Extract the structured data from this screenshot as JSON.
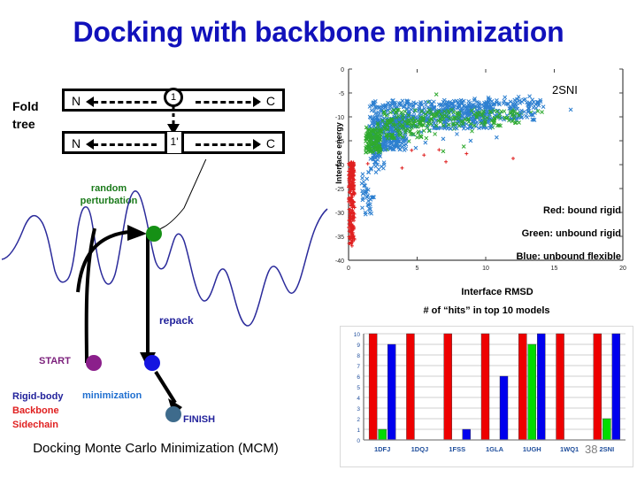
{
  "title": "Docking with backbone minimization",
  "fold_tree": {
    "label": "Fold\ntree",
    "label_line1": "Fold",
    "label_line2": "tree",
    "row1": {
      "n_terminus": "N",
      "c_terminus": "C",
      "node": "1"
    },
    "row2": {
      "n_terminus": "N",
      "c_terminus": "C",
      "node": "1'"
    }
  },
  "mcm": {
    "random_perturbation": "random\nperturbation",
    "random_perturbation_line1": "random",
    "random_perturbation_line2": "perturbation",
    "repack_label": "repack",
    "start_label": "START",
    "finish_label": "FINISH",
    "minimization_label": "minimization",
    "dof_legend": {
      "rigid_body": "Rigid-body",
      "backbone": "Backbone",
      "sidechain": "Sidechain"
    },
    "caption": "Docking Monte Carlo Minimization (MCM)",
    "colors": {
      "start_dot": "#8b1f8b",
      "green_dot": "#159015",
      "blue_dot": "#1515e0",
      "finish_dot": "#3e6b8c",
      "curve": "#2b2b9b"
    }
  },
  "scatter_legend": {
    "red": "Red: bound rigid",
    "green": "Green: unbound rigid",
    "blue": "Blue: unbound flexible"
  },
  "bar_chart_title": "# of “hits” in top 10 models",
  "page_number": "38",
  "chart_data": [
    {
      "type": "scatter",
      "title": "2SNI",
      "xlabel": "Interface RMSD",
      "ylabel": "Interface energy",
      "xlim": [
        0,
        20
      ],
      "ylim": [
        -40,
        0
      ],
      "xticks": [
        0,
        5,
        10,
        15,
        20
      ],
      "yticks": [
        0,
        -5,
        -10,
        -15,
        -20,
        -25,
        -30,
        -35,
        -40
      ],
      "grid": false,
      "legend_position": "inside-bottom-right",
      "series": [
        {
          "name": "bound rigid",
          "color": "#e02020",
          "marker": "plus",
          "points": [
            [
              0.15,
              -20.2
            ],
            [
              0.2,
              -21.0
            ],
            [
              0.1,
              -21.6
            ],
            [
              0.25,
              -22.1
            ],
            [
              0.3,
              -22.5
            ],
            [
              0.18,
              -23.0
            ],
            [
              0.12,
              -23.4
            ],
            [
              0.22,
              -23.9
            ],
            [
              0.28,
              -24.3
            ],
            [
              0.16,
              -24.8
            ],
            [
              0.2,
              -25.2
            ],
            [
              0.35,
              -25.6
            ],
            [
              0.14,
              -26.0
            ],
            [
              0.26,
              -26.4
            ],
            [
              0.19,
              -26.9
            ],
            [
              0.23,
              -27.3
            ],
            [
              0.3,
              -27.7
            ],
            [
              0.17,
              -28.1
            ],
            [
              0.21,
              -28.6
            ],
            [
              0.29,
              -29.0
            ],
            [
              0.13,
              -29.4
            ],
            [
              0.24,
              -29.8
            ],
            [
              0.2,
              -30.2
            ],
            [
              0.32,
              -30.7
            ],
            [
              0.15,
              -31.1
            ],
            [
              0.27,
              -31.5
            ],
            [
              0.18,
              -31.9
            ],
            [
              0.22,
              -32.4
            ],
            [
              0.3,
              -32.8
            ],
            [
              0.16,
              -33.2
            ],
            [
              0.24,
              -33.6
            ],
            [
              0.2,
              -34.1
            ],
            [
              0.28,
              -34.5
            ],
            [
              0.14,
              -34.9
            ],
            [
              0.26,
              -35.3
            ],
            [
              0.19,
              -35.8
            ],
            [
              0.23,
              -36.2
            ],
            [
              0.21,
              -36.6
            ],
            [
              0.25,
              -37.0
            ],
            [
              0.2,
              -19.5
            ],
            [
              1.4,
              -19.8
            ],
            [
              3.9,
              -20.7
            ],
            [
              7.1,
              -19.4
            ],
            [
              12.0,
              -18.7
            ],
            [
              6.6,
              -16.9
            ],
            [
              4.6,
              -17.0
            ],
            [
              8.6,
              -17.7
            ],
            [
              5.5,
              -18.0
            ]
          ]
        },
        {
          "name": "unbound rigid",
          "color": "#2faa2f",
          "marker": "x",
          "points": [
            [
              1.5,
              -13.3
            ],
            [
              1.6,
              -14.1
            ],
            [
              1.7,
              -14.8
            ],
            [
              1.8,
              -15.4
            ],
            [
              1.9,
              -16.0
            ],
            [
              2.0,
              -16.5
            ],
            [
              2.1,
              -15.2
            ],
            [
              2.2,
              -14.5
            ],
            [
              1.4,
              -12.8
            ],
            [
              1.3,
              -12.2
            ],
            [
              2.4,
              -13.9
            ],
            [
              2.6,
              -13.2
            ],
            [
              2.9,
              -12.6
            ],
            [
              3.3,
              -12.0
            ],
            [
              3.7,
              -11.5
            ],
            [
              4.2,
              -11.2
            ],
            [
              4.8,
              -10.9
            ],
            [
              5.4,
              -10.6
            ],
            [
              6.0,
              -10.4
            ],
            [
              6.7,
              -10.2
            ],
            [
              7.3,
              -10.0
            ],
            [
              8.0,
              -9.9
            ],
            [
              8.8,
              -9.7
            ],
            [
              9.5,
              -9.6
            ],
            [
              10.3,
              -9.5
            ],
            [
              11.0,
              -9.4
            ],
            [
              11.8,
              -9.3
            ],
            [
              12.6,
              -9.2
            ],
            [
              13.3,
              -9.1
            ],
            [
              14.1,
              -9.0
            ],
            [
              7.7,
              -12.5
            ],
            [
              9.0,
              -13.0
            ],
            [
              10.5,
              -12.2
            ],
            [
              6.3,
              -13.6
            ],
            [
              5.0,
              -14.3
            ],
            [
              4.4,
              -15.1
            ],
            [
              3.5,
              -15.8
            ],
            [
              2.8,
              -16.8
            ],
            [
              8.4,
              -16.2
            ],
            [
              6.9,
              -17.2
            ],
            [
              5.8,
              -6.9
            ],
            [
              6.4,
              -5.3
            ],
            [
              9.2,
              -8.1
            ],
            [
              12.0,
              -8.4
            ],
            [
              13.8,
              -8.8
            ]
          ]
        },
        {
          "name": "unbound flexible",
          "color": "#2d7fd0",
          "marker": "x",
          "points": [
            [
              1.0,
              -22.8
            ],
            [
              1.1,
              -23.6
            ],
            [
              1.2,
              -24.4
            ],
            [
              1.3,
              -25.1
            ],
            [
              1.25,
              -26.0
            ],
            [
              1.35,
              -26.8
            ],
            [
              1.45,
              -27.6
            ],
            [
              1.4,
              -28.4
            ],
            [
              1.5,
              -29.2
            ],
            [
              1.55,
              -30.0
            ],
            [
              1.9,
              -18.6
            ],
            [
              2.0,
              -19.4
            ],
            [
              2.1,
              -20.0
            ],
            [
              2.2,
              -18.1
            ],
            [
              2.3,
              -17.4
            ],
            [
              2.4,
              -16.8
            ],
            [
              2.5,
              -16.2
            ],
            [
              2.6,
              -15.7
            ],
            [
              2.7,
              -15.1
            ],
            [
              2.8,
              -14.6
            ],
            [
              2.9,
              -14.0
            ],
            [
              3.0,
              -13.5
            ],
            [
              3.2,
              -13.0
            ],
            [
              3.4,
              -12.5
            ],
            [
              3.6,
              -12.0
            ],
            [
              3.8,
              -11.6
            ],
            [
              4.0,
              -11.2
            ],
            [
              4.3,
              -10.8
            ],
            [
              4.6,
              -10.4
            ],
            [
              4.9,
              -10.1
            ],
            [
              5.2,
              -9.8
            ],
            [
              5.6,
              -9.5
            ],
            [
              6.0,
              -9.2
            ],
            [
              6.4,
              -9.0
            ],
            [
              6.8,
              -8.8
            ],
            [
              7.2,
              -8.6
            ],
            [
              7.6,
              -8.4
            ],
            [
              8.0,
              -8.2
            ],
            [
              8.5,
              -8.0
            ],
            [
              9.0,
              -7.9
            ],
            [
              9.5,
              -7.7
            ],
            [
              10.0,
              -7.6
            ],
            [
              10.5,
              -7.5
            ],
            [
              11.0,
              -7.4
            ],
            [
              11.5,
              -7.3
            ],
            [
              12.0,
              -7.2
            ],
            [
              12.5,
              -7.1
            ],
            [
              13.0,
              -7.0
            ],
            [
              13.5,
              -6.9
            ],
            [
              14.0,
              -6.8
            ],
            [
              3.1,
              -15.5
            ],
            [
              3.5,
              -14.8
            ],
            [
              4.1,
              -14.2
            ],
            [
              4.7,
              -13.7
            ],
            [
              5.3,
              -13.2
            ],
            [
              5.9,
              -12.8
            ],
            [
              6.5,
              -12.4
            ],
            [
              7.1,
              -12.0
            ],
            [
              7.8,
              -11.7
            ],
            [
              8.4,
              -11.4
            ],
            [
              9.1,
              -11.1
            ],
            [
              9.8,
              -10.8
            ],
            [
              10.4,
              -10.5
            ],
            [
              11.2,
              -10.2
            ],
            [
              12.1,
              -10.0
            ],
            [
              2.6,
              -12.3
            ],
            [
              3.0,
              -11.0
            ],
            [
              3.7,
              -10.2
            ],
            [
              4.4,
              -9.3
            ],
            [
              5.1,
              -8.7
            ],
            [
              5.8,
              -8.0
            ],
            [
              6.6,
              -7.4
            ],
            [
              7.4,
              -6.9
            ],
            [
              8.2,
              -6.5
            ],
            [
              9.2,
              -6.2
            ],
            [
              10.2,
              -6.0
            ],
            [
              11.4,
              -5.9
            ],
            [
              12.4,
              -5.8
            ],
            [
              13.2,
              -5.7
            ],
            [
              14.2,
              -7.9
            ],
            [
              16.2,
              -8.5
            ],
            [
              2.2,
              -21.0
            ],
            [
              2.0,
              -21.6
            ],
            [
              2.4,
              -20.4
            ],
            [
              6.9,
              -14.6
            ],
            [
              10.8,
              -14.3
            ],
            [
              8.9,
              -15.0
            ],
            [
              4.9,
              -16.5
            ],
            [
              5.6,
              -15.4
            ],
            [
              7.9,
              -13.6
            ]
          ]
        }
      ]
    },
    {
      "type": "bar",
      "title": "# of “hits” in top 10 models",
      "categories": [
        "1DFJ",
        "1DQJ",
        "1FSS",
        "1GLA",
        "1UGH",
        "1WQ1",
        "2SNI"
      ],
      "xlabel": "",
      "ylabel": "",
      "ylim": [
        0,
        10
      ],
      "yticks": [
        0,
        1,
        2,
        3,
        4,
        5,
        6,
        7,
        8,
        9,
        10
      ],
      "grid": true,
      "legend_position": "none",
      "series": [
        {
          "name": "bound rigid",
          "color": "#ee0000",
          "values": [
            10,
            10,
            10,
            10,
            10,
            10,
            10
          ]
        },
        {
          "name": "unbound rigid",
          "color": "#00dd00",
          "values": [
            1,
            0,
            0,
            0,
            9,
            0,
            2
          ]
        },
        {
          "name": "unbound flexible",
          "color": "#0000ee",
          "values": [
            9,
            0,
            1,
            6,
            10,
            0,
            10
          ]
        }
      ]
    }
  ]
}
